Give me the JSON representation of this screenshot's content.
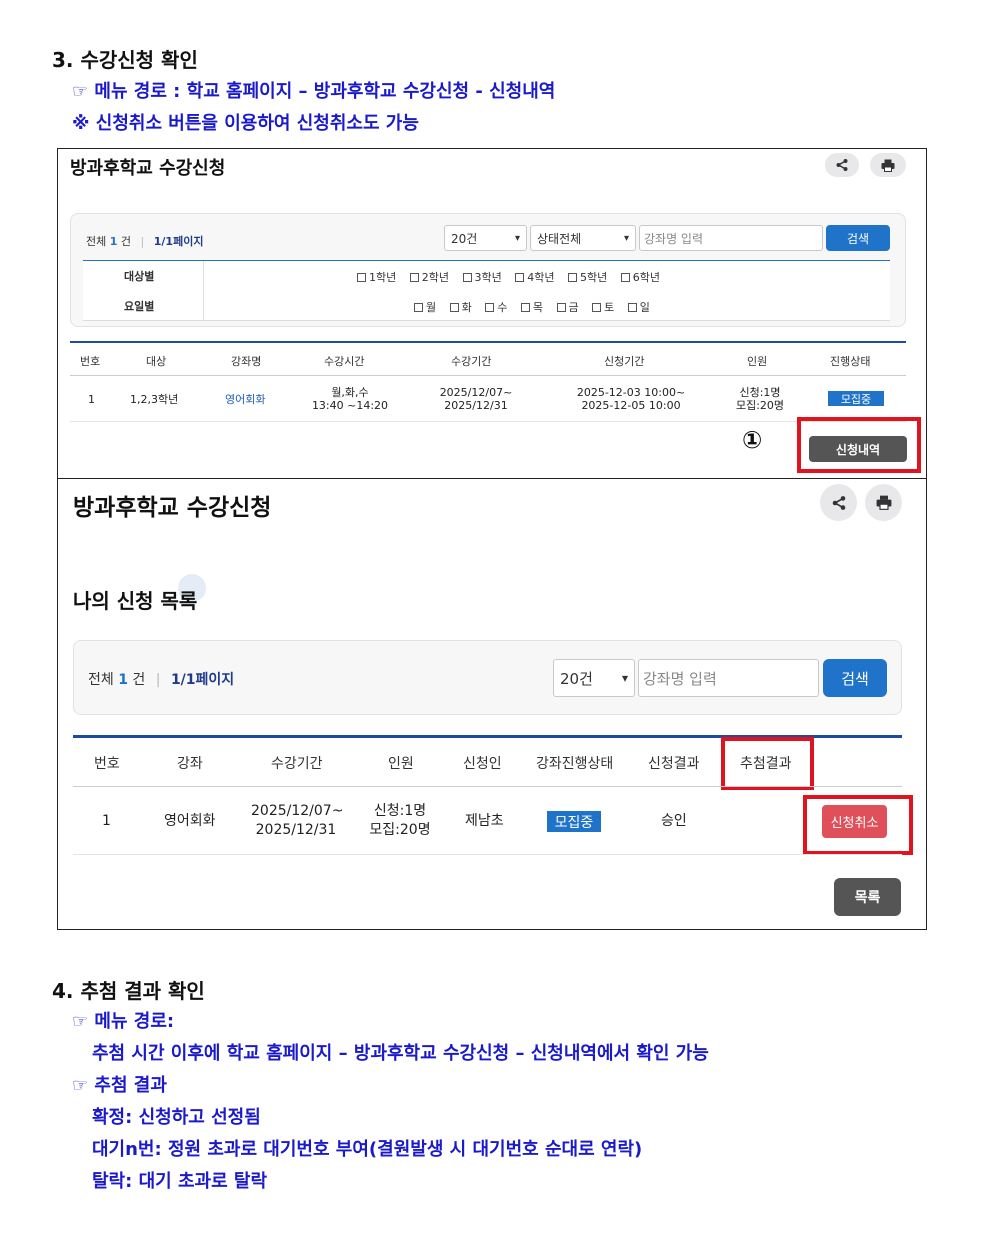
{
  "section3": {
    "heading": "3. 수강신청 확인",
    "line1": "☞ 메뉴 경로 : 학교 홈페이지 – 방과후학교 수강신청 - 신청내역",
    "line2": "※ 신청취소 버튼을 이용하여 신청취소도 가능"
  },
  "panel1": {
    "title": "방과후학교 수강신청",
    "filter": {
      "total_prefix": "전체",
      "total_count": "1",
      "total_suffix": "건",
      "page": "1/1페이지",
      "per_page": "20건",
      "status": "상태전체",
      "search_placeholder": "강좌명 입력",
      "search_button": "검색",
      "target_label": "대상별",
      "target_options": [
        "1학년",
        "2학년",
        "3학년",
        "4학년",
        "5학년",
        "6학년"
      ],
      "day_label": "요일별",
      "day_options": [
        "월",
        "화",
        "수",
        "목",
        "금",
        "토",
        "일"
      ]
    },
    "table": {
      "headers": [
        "번호",
        "대상",
        "강좌명",
        "수강시간",
        "수강기간",
        "신청기간",
        "인원",
        "진행상태"
      ],
      "row": {
        "no": "1",
        "target": "1,2,3학년",
        "course": "영어회화",
        "time1": "월,화,수",
        "time2": "13:40 ~14:20",
        "period1": "2025/12/07~",
        "period2": "2025/12/31",
        "apply1": "2025-12-03 10:00~",
        "apply2": "2025-12-05 10:00",
        "people1": "신청:1명",
        "people2": "모집:20명",
        "status": "모집중"
      }
    },
    "step_marker": "①",
    "history_button": "신청내역"
  },
  "panel2": {
    "title": "방과후학교 수강신청",
    "subtitle": "나의 신청 목록",
    "filter": {
      "total_prefix": "전체",
      "total_count": "1",
      "total_suffix": "건",
      "page": "1/1페이지",
      "per_page": "20건",
      "search_placeholder": "강좌명 입력",
      "search_button": "검색"
    },
    "table": {
      "headers": [
        "번호",
        "강좌",
        "수강기간",
        "인원",
        "신청인",
        "강좌진행상태",
        "신청결과",
        "추첨결과"
      ],
      "row": {
        "no": "1",
        "course": "영어회화",
        "period1": "2025/12/07~",
        "period2": "2025/12/31",
        "people1": "신청:1명",
        "people2": "모집:20명",
        "applicant": "제남초",
        "status": "모집중",
        "result": "승인",
        "cancel": "신청취소"
      }
    },
    "list_button": "목록"
  },
  "section4": {
    "heading": "4. 추첨 결과 확인",
    "l1": "☞ 메뉴 경로:",
    "l2": "추첨 시간 이후에 학교 홈페이지 – 방과후학교 수강신청 – 신청내역에서 확인 가능",
    "l3": "☞ 추첨 결과",
    "l4": "확정: 신청하고 선정됨",
    "l5": "대기n번: 정원 초과로 대기번호 부여(결원발생 시 대기번호 순대로 연락)",
    "l6": "탈락: 대기 초과로 탈락"
  },
  "colors": {
    "text_blue": "#1a1acc",
    "button_blue": "#1f73c9",
    "highlight_red": "#e0141e",
    "cancel_red": "#e0505a",
    "dark_button": "#555555"
  },
  "icons": [
    "share-icon",
    "print-icon"
  ]
}
